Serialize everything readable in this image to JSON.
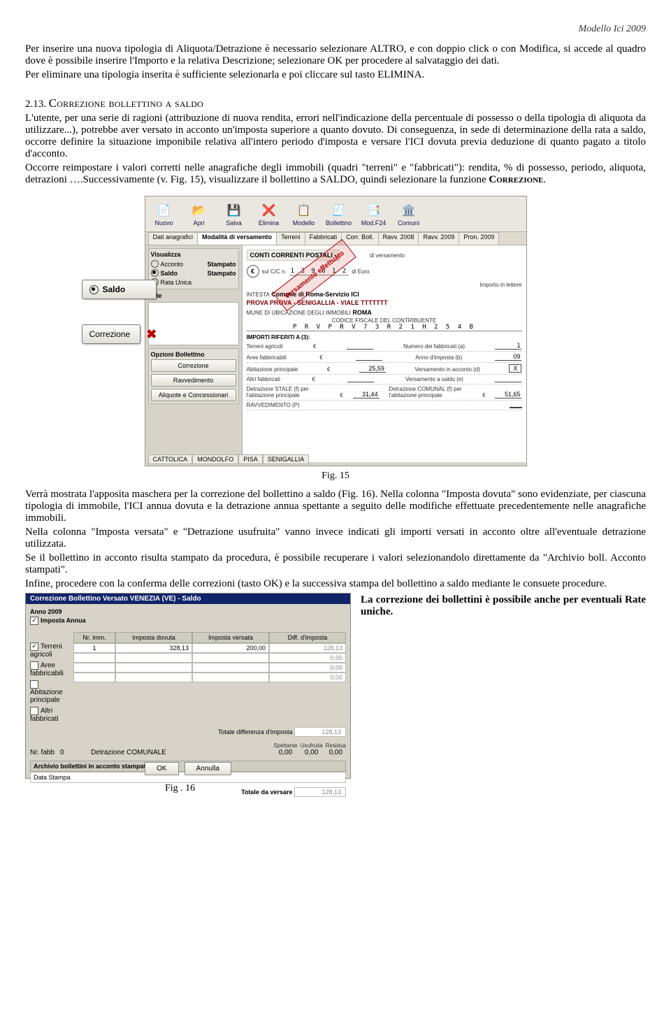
{
  "header": {
    "doc_title": "Modello Ici 2009"
  },
  "para1": "Per inserire una nuova tipologia di Aliquota/Detrazione è necessario selezionare ALTRO, e con doppio click o con Modifica, si accede al quadro dove è possibile inserire l'Importo e la relativa Descrizione; selezionare OK per procedere al salvataggio dei dati.",
  "para1b": "Per eliminare una tipologia inserita è sufficiente selezionarla e poi cliccare sul tasto ELIMINA.",
  "section": {
    "num": "2.13.",
    "title": "Correzione bollettino a saldo"
  },
  "para2a": "L'utente, per una serie di ragioni (attribuzione di nuova rendita, errori nell'indicazione della percentuale di possesso o della tipologia di aliquota da utilizzare...), potrebbe aver versato in acconto un'imposta superiore a quanto dovuto. Di conseguenza, in sede di determinazione della rata a saldo, occorre definire la situazione imponibile relativa all'intero periodo d'imposta e versare l'ICI dovuta previa deduzione di quanto pagato a titolo d'acconto.",
  "para2b": "Occorre reimpostare i valori corretti nelle anagrafiche degli immobili (quadri \"terreni\" e \"fabbricati\"): rendita, % di possesso, periodo, aliquota, detrazioni ….Successivamente (v. Fig. 15), visualizzare il bollettino a SALDO, quindi selezionare la funzione ",
  "para2b_bold": "Correzione",
  "para2b_end": ".",
  "fig15_caption": "Fig. 15",
  "para3": "Verrà mostrata l'apposita maschera per la correzione del bollettino a saldo (Fig. 16). Nella colonna \"Imposta dovuta\" sono evidenziate, per ciascuna tipologia di immobile, l'ICI annua dovuta e la detrazione annua spettante a seguito delle modifiche effettuate precedentemente nelle anagrafiche immobili.",
  "para3b": "Nella colonna \"Imposta versata\" e \"Detrazione usufruita\" vanno invece indicati gli importi versati in acconto oltre all'eventuale detrazione utilizzata.",
  "para3c": "Se il bollettino in acconto risulta stampato da procedura, è possibile recuperare i valori selezionandolo direttamente da \"Archivio boll. Acconto stampati\".",
  "para3d": "Infine, procedere con la conferma delle correzioni (tasto OK) e la successiva stampa del bollettino a saldo mediante le consuete procedure.",
  "side_text": "La correzione dei bollettini è possibile anche per eventuali Rate uniche.",
  "fig16_caption": "Fig . 16",
  "shot15": {
    "toolbar": [
      "Nuovo",
      "Apri",
      "Salva",
      "Elimina",
      "Modello",
      "Bollettino",
      "Mod.F24",
      "Comuni"
    ],
    "tabs": [
      "Dati anagrafici",
      "Modalità di versamento",
      "Terreni",
      "Fabbricati",
      "Corr. Boll.",
      "Ravv. 2008",
      "Ravv. 2009",
      "Pron. 2009"
    ],
    "visualizza": {
      "title": "Visualizza",
      "acconto": "Acconto",
      "acconto_s": "Stampato",
      "saldo": "Saldo",
      "saldo_s": "Stampato",
      "rata": "Rata Unica"
    },
    "note_lbl": "Note",
    "opzioni": {
      "title": "Opzioni Bollettino",
      "correzione": "Correzione",
      "ravv": "Ravvedimento",
      "aliq": "Aliquote e Concessionari"
    },
    "cc_title": "CONTI CORRENTI POSTALI -",
    "cc_suffix": "di versamento",
    "ccn_lbl": "sul C/C n.",
    "ccn": "1 3 9 6 1 2",
    "ccn_suffix": "di Euro",
    "intesta_lbl": "INTESTA",
    "intesta_val": "Comune di Roma-Servizio ICI",
    "eseguito": "PROVA PROVA - SENIGALLIA - VIALE TTTTTTT",
    "ubicazione_lbl": "MUNE DI UBICAZIONE DEGLI IMMOBILI",
    "ubicazione": "ROMA",
    "cf_lbl": "CODICE FISCALE DEL CONTRIBUENTE",
    "cf": "P R V P R V 7 3 R 2 1 H 2 5 4 B",
    "imp_lbl": "IMPORTI RIFERITI A (3):",
    "rows": {
      "terreni": "Terreni agricoli",
      "nfabb_lbl": "Numero dei fabbricati (a)",
      "nfabb": "1",
      "aree": "Aree fabbricabili",
      "anno_lbl": "Anno d'imposta (b)",
      "anno": "09",
      "ab": "Abitazione principale",
      "ab_val": "25,59",
      "vacc_lbl": "Versamento in acconto (d)",
      "vacc": "X",
      "altri": "Altri fabbricati",
      "vsal_lbl": "Versamento a saldo (e)",
      "det_st_lbl": "Detrazione STALE (f) per l'abitazione principale",
      "det_st": "31,44",
      "det_com_lbl": "Detrazione COMUNAL (f) per l'abitazione principale",
      "det_com": "51,65",
      "ravv": "RAVVEDIMENTO (P)"
    },
    "stamp": "Versamento effettuato",
    "footer_tabs": [
      "CATTOLICA",
      "MONDOLFO",
      "PISA",
      "SENIGALLIA"
    ],
    "float": {
      "saldo": "Saldo",
      "correzione": "Correzione"
    }
  },
  "shot16": {
    "title": "Correzione Bollettino Versato VENEZIA (VE) - Saldo",
    "anno_lbl": "Anno 2009",
    "imposta_annua": "Imposta Annua",
    "rows_lbl": {
      "terreni": "Terreni agricoli",
      "aree": "Aree fabbricabili",
      "ab": "Abitazione principale",
      "altri": "Altri fabbricati"
    },
    "head": {
      "nrimm": "Nr. imm.",
      "dovuta": "Imposta dovuta",
      "versata": "Imposta versata",
      "diff": "Diff. d'imposta"
    },
    "r1": {
      "n": "1",
      "dov": "328,13",
      "ver": "200,00",
      "dif": "128,13"
    },
    "zeri": "0,00",
    "tot_diff_lbl": "Totale differenza d'imposta",
    "tot_diff": "128,13",
    "nrfabb_lbl": "Nr. fabb",
    "nrfabb": "0",
    "detcom_lbl": "Detrazione COMUNALE",
    "spett": "Spettante",
    "usufr": "Usufruita",
    "resid": "Residua",
    "arch": "Archivio bollettini in acconto stampati",
    "datastampa": "Data Stampa",
    "totvers_lbl": "Totale da versare",
    "totvers": "128,13",
    "ok": "OK",
    "annulla": "Annulla"
  }
}
